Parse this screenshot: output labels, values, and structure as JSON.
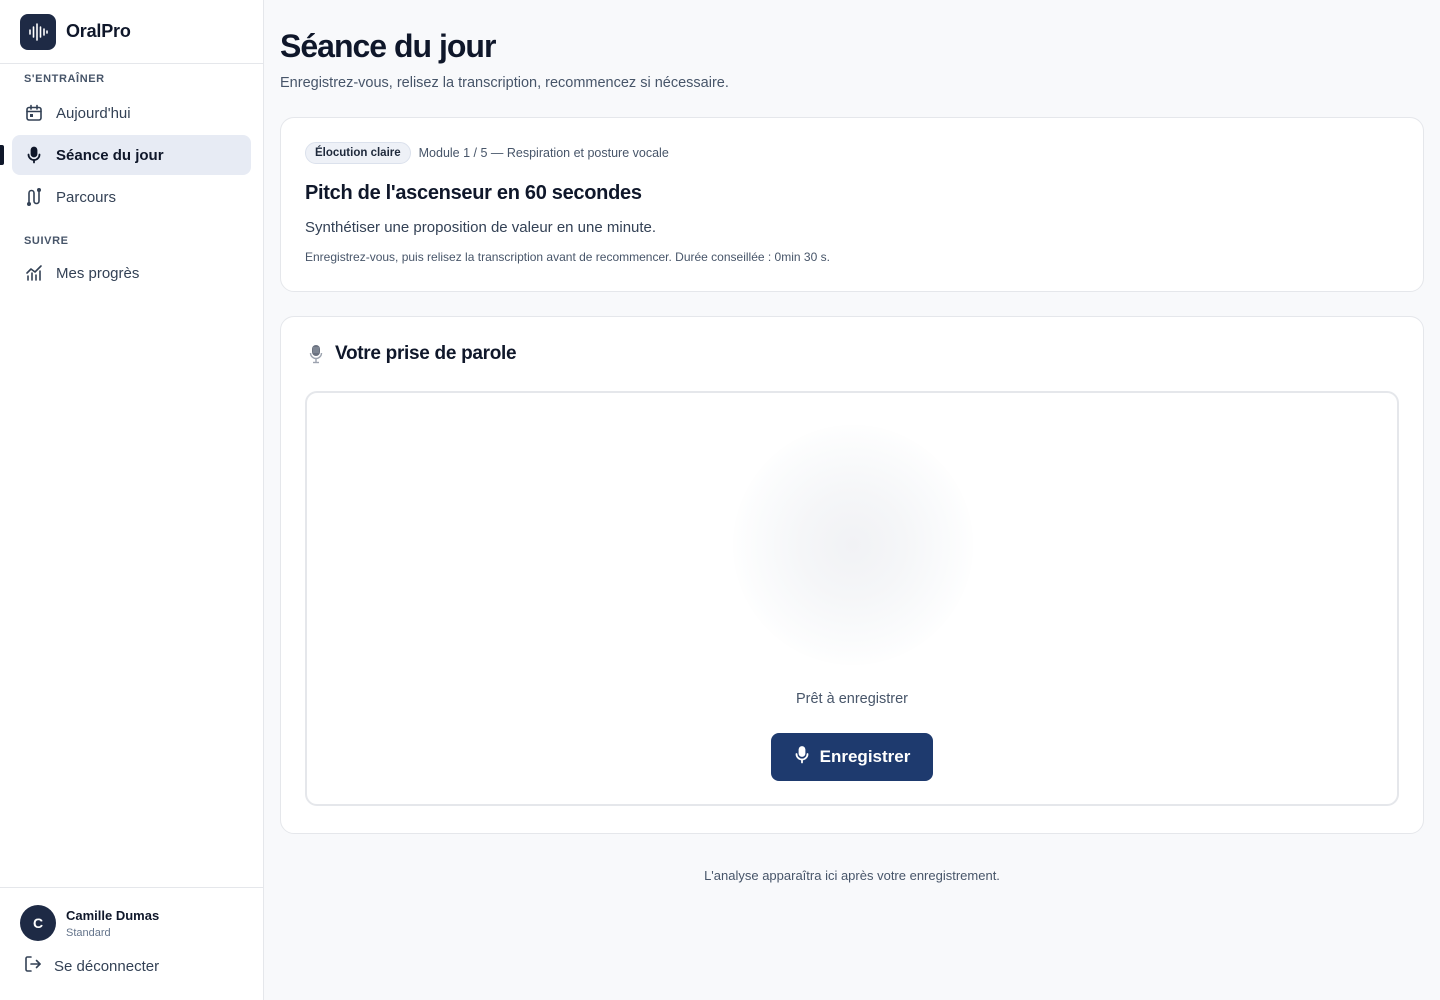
{
  "app": {
    "name": "OralPro"
  },
  "sidebar": {
    "sections": [
      {
        "title": "S'ENTRAÎNER",
        "items": [
          {
            "label": "Aujourd'hui",
            "icon": "calendar-icon",
            "active": false
          },
          {
            "label": "Séance du jour",
            "icon": "microphone-icon",
            "active": true
          },
          {
            "label": "Parcours",
            "icon": "route-icon",
            "active": false
          }
        ]
      },
      {
        "title": "SUIVRE",
        "items": [
          {
            "label": "Mes progrès",
            "icon": "chart-icon",
            "active": false
          }
        ]
      }
    ],
    "user": {
      "initial": "C",
      "name": "Camille Dumas",
      "plan": "Standard"
    },
    "logout_label": "Se déconnecter"
  },
  "page": {
    "title": "Séance du jour",
    "subtitle": "Enregistrez-vous, relisez la transcription, recommencez si nécessaire."
  },
  "exercise": {
    "badge": "Élocution claire",
    "module": "Module 1 / 5 — Respiration et posture vocale",
    "title": "Pitch de l'ascenseur en 60 secondes",
    "description": "Synthétiser une proposition de valeur en une minute.",
    "hint": "Enregistrez-vous, puis relisez la transcription avant de recommencer. Durée conseillée : 0min 30 s."
  },
  "recorder": {
    "title": "Votre prise de parole",
    "status": "Prêt à enregistrer",
    "button_label": "Enregistrer"
  },
  "analysis_note": "L'analyse apparaîtra ici après votre enregistrement.",
  "colors": {
    "brand": "#1e2a45",
    "primary_button": "#1e3a6e",
    "active_nav_bg": "#e7ebf4"
  }
}
